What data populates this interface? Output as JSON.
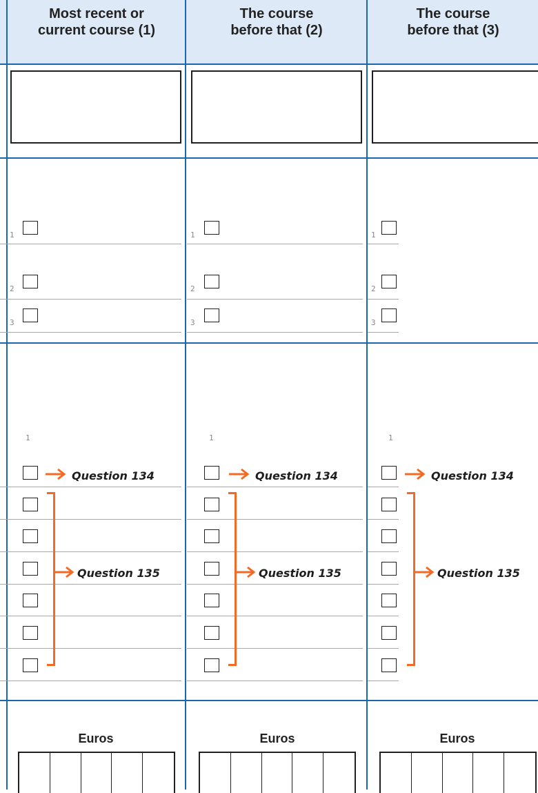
{
  "columns": [
    {
      "header": "Most recent or\ncurrent course (1)"
    },
    {
      "header": "The course\nbefore that (2)"
    },
    {
      "header": "The course\nbefore that (3)"
    }
  ],
  "codes": {
    "one": "1",
    "two": "2",
    "three": "3"
  },
  "questions": {
    "q134": "Question 134",
    "q135": "Question 135"
  },
  "euros_label": "Euros",
  "colors": {
    "rule": "#1a66b0",
    "header_bg": "#dde9f6",
    "arrow": "#f26a24"
  }
}
